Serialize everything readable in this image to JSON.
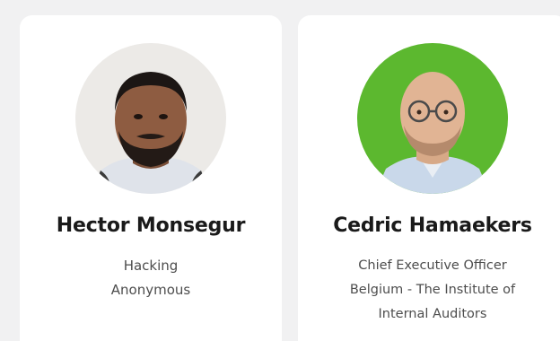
{
  "speakers": [
    {
      "name": "Hector Monsegur",
      "role_lines": [
        "Hacking",
        "Anonymous"
      ],
      "avatar_bg": "#eceae7"
    },
    {
      "name": "Cedric Hamaekers",
      "role_lines": [
        "Chief Executive Officer",
        "Belgium - The Institute of",
        "Internal Auditors"
      ],
      "avatar_bg": "#5cb82f"
    }
  ]
}
